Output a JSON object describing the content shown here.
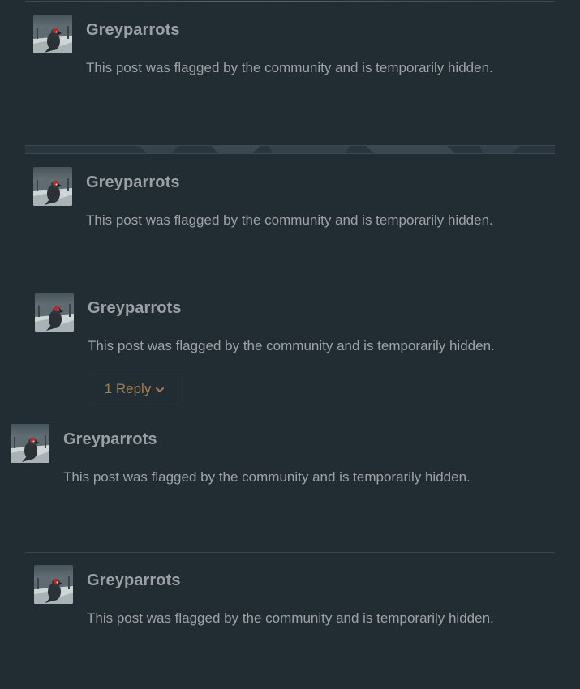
{
  "posts": [
    {
      "author": "Greyparrots",
      "message": "This post was flagged by the community and is temporarily hidden."
    },
    {
      "author": "Greyparrots",
      "message": "This post was flagged by the community and is temporarily hidden."
    },
    {
      "author": "Greyparrots",
      "message": "This post was flagged by the community and is temporarily hidden."
    },
    {
      "author": "Greyparrots",
      "message": "This post was flagged by the community and is temporarily hidden."
    },
    {
      "author": "Greyparrots",
      "message": "This post was flagged by the community and is temporarily hidden."
    }
  ],
  "reply_toggle": {
    "label": "1 Reply",
    "icon": "chevron-down-icon"
  },
  "avatar": {
    "icon": "parrot-avatar-icon"
  },
  "colors": {
    "background": "#222c33",
    "author": "#9aa0a3",
    "message": "#9ea3a6",
    "reply_accent": "#a57f4f",
    "divider": "#3a464e"
  }
}
